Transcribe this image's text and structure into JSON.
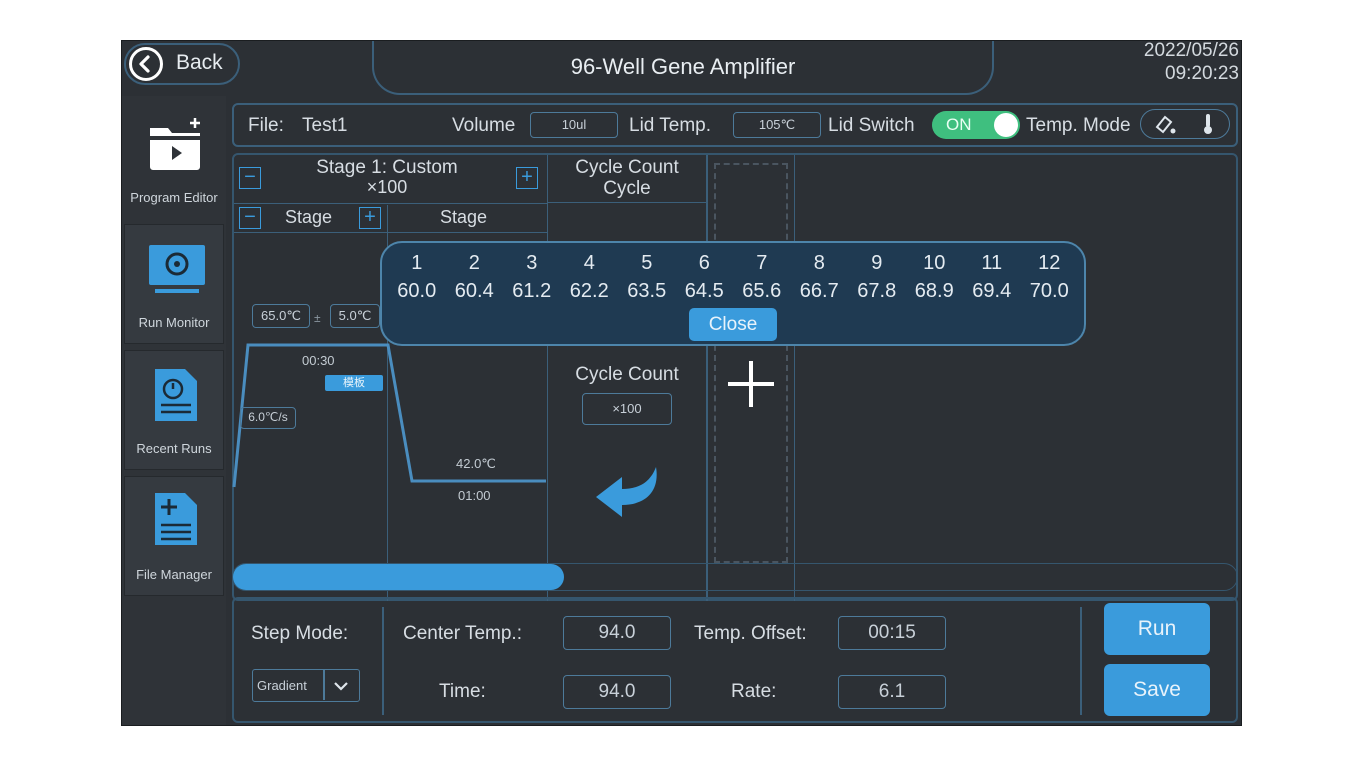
{
  "header": {
    "back_label": "Back",
    "title": "96-Well Gene Amplifier",
    "date": "2022/05/26",
    "time": "09:20:23"
  },
  "sidebar": {
    "items": [
      {
        "label": "Program Editor"
      },
      {
        "label": "Run Monitor"
      },
      {
        "label": "Recent Runs"
      },
      {
        "label": "File Manager"
      }
    ]
  },
  "file_bar": {
    "file_label": "File:",
    "file_name": "Test1",
    "volume_label": "Volume",
    "volume_value": "10ul",
    "lid_temp_label": "Lid Temp.",
    "lid_temp_value": "105℃",
    "lid_switch_label": "Lid Switch",
    "lid_switch_state": "ON",
    "temp_mode_label": "Temp. Mode"
  },
  "stage_panel": {
    "stage_title": "Stage 1: Custom",
    "stage_repeat": "×100",
    "col1_label": "Stage",
    "col2_label": "Stage",
    "cycle_header_1": "Cycle Count",
    "cycle_header_2": "Cycle",
    "temp_field_1": "65.0℃",
    "temp_field_2": "5.0℃",
    "ramp_rate": "6.0℃/s",
    "step1_time": "00:30",
    "step1_tag": "模板",
    "step2_temp": "42.0℃",
    "step2_time": "01:00",
    "cycle_count_label": "Cycle Count",
    "cycle_count_value": "×100"
  },
  "popup": {
    "columns": [
      {
        "num": "1",
        "temp": "60.0"
      },
      {
        "num": "2",
        "temp": "60.4"
      },
      {
        "num": "3",
        "temp": "61.2"
      },
      {
        "num": "4",
        "temp": "62.2"
      },
      {
        "num": "5",
        "temp": "63.5"
      },
      {
        "num": "6",
        "temp": "64.5"
      },
      {
        "num": "7",
        "temp": "65.6"
      },
      {
        "num": "8",
        "temp": "66.7"
      },
      {
        "num": "9",
        "temp": "67.8"
      },
      {
        "num": "10",
        "temp": "68.9"
      },
      {
        "num": "11",
        "temp": "69.4"
      },
      {
        "num": "12",
        "temp": "70.0"
      }
    ],
    "close_label": "Close"
  },
  "scrollbar": {
    "position_fraction": 0.33
  },
  "bottom": {
    "step_mode_label": "Step Mode:",
    "step_mode_value": "Gradient",
    "center_temp_label": "Center Temp.:",
    "center_temp_value": "94.0",
    "temp_offset_label": "Temp. Offset:",
    "temp_offset_value": "00:15",
    "time_label": "Time:",
    "time_value": "94.0",
    "rate_label": "Rate:",
    "rate_value": "6.1",
    "run_label": "Run",
    "save_label": "Save"
  },
  "colors": {
    "accent": "#3a9bdc",
    "toggle_on": "#3fbf7f",
    "background": "#2c3035",
    "popup_bg": "#1f3a52"
  }
}
